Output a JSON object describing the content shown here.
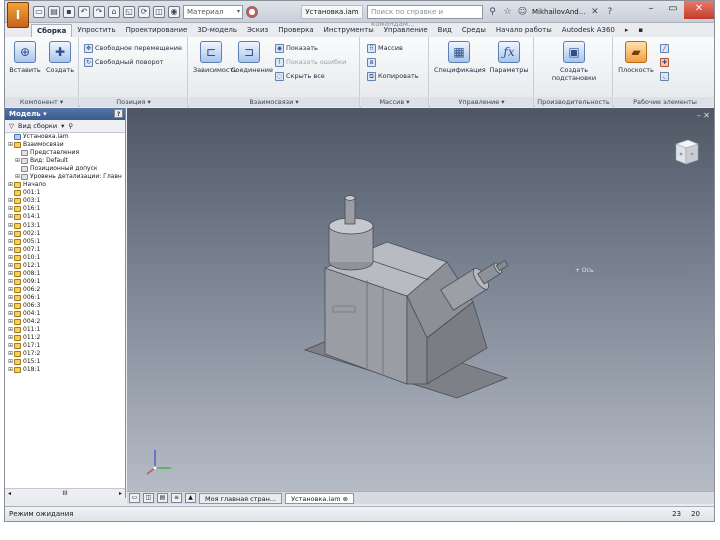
{
  "titlebar": {
    "material": "Материал",
    "doc_title": "Установка.iam",
    "search_placeholder": "Поиск по справке и командам...",
    "user": "MikhailovAnd...",
    "help": "?"
  },
  "tabs": [
    "Сборка",
    "Упростить",
    "Проектирование",
    "3D-модель",
    "Эскиз",
    "Проверка",
    "Инструменты",
    "Управление",
    "Вид",
    "Среды",
    "Начало работы",
    "Autodesk A360"
  ],
  "active_tab": 0,
  "ribbon": {
    "component": {
      "label": "Компонент ▾",
      "insert": "Вставить",
      "create": "Создать"
    },
    "position": {
      "label": "Позиция ▾",
      "free_move": "Свободное перемещение",
      "free_rotate": "Свободный поворот"
    },
    "relationships": {
      "label": "Взаимосвязи ▾",
      "constrain": "Зависимость",
      "join": "Соединение",
      "show": "Показать",
      "show_sick": "Показать ошибки",
      "hide_all": "Скрыть все"
    },
    "pattern": {
      "label": "Массив ▾",
      "pattern": "Массив",
      "copy": "Копировать"
    },
    "manage": {
      "label": "Управление ▾",
      "bom": "Спецификация",
      "parameters": "Параметры"
    },
    "productivity": {
      "label": "Производительность",
      "create_substitutes": "Создать подстановки"
    },
    "work_features": {
      "label": "Рабочие элементы",
      "plane": "Плоскость"
    }
  },
  "browser": {
    "title": "Модель ▾",
    "help": "?",
    "view": "Вид сборки",
    "scroll_left": "◂",
    "scroll_mid": "III",
    "scroll_right": "▸",
    "tree": [
      {
        "label": "Установка.iam",
        "icon": "assembly",
        "indent": 0,
        "exp": ""
      },
      {
        "label": "Взаимосвязи",
        "icon": "folder",
        "indent": 0,
        "exp": "⊞"
      },
      {
        "label": "Представления",
        "icon": "plain",
        "indent": 1,
        "exp": ""
      },
      {
        "label": "Вид: Default",
        "icon": "plain",
        "indent": 1,
        "exp": "⊞"
      },
      {
        "label": "Позиционный допуск",
        "icon": "plain",
        "indent": 1,
        "exp": ""
      },
      {
        "label": "Уровень детализации: Главн",
        "icon": "plain",
        "indent": 1,
        "exp": "⊞"
      },
      {
        "label": "Начало",
        "icon": "folder",
        "indent": 0,
        "exp": "⊞"
      },
      {
        "label": "001:1",
        "icon": "part",
        "indent": 0,
        "exp": ""
      },
      {
        "label": "003:1",
        "icon": "part",
        "indent": 0,
        "exp": "⊞"
      },
      {
        "label": "016:1",
        "icon": "part",
        "indent": 0,
        "exp": "⊞"
      },
      {
        "label": "014:1",
        "icon": "part",
        "indent": 0,
        "exp": "⊞"
      },
      {
        "label": "013:1",
        "icon": "part",
        "indent": 0,
        "exp": "⊞"
      },
      {
        "label": "002:1",
        "icon": "part",
        "indent": 0,
        "exp": "⊞"
      },
      {
        "label": "005:1",
        "icon": "part",
        "indent": 0,
        "exp": "⊞"
      },
      {
        "label": "007:1",
        "icon": "part",
        "indent": 0,
        "exp": "⊞"
      },
      {
        "label": "010:1",
        "icon": "part",
        "indent": 0,
        "exp": "⊞"
      },
      {
        "label": "012:1",
        "icon": "part",
        "indent": 0,
        "exp": "⊞"
      },
      {
        "label": "008:1",
        "icon": "part",
        "indent": 0,
        "exp": "⊞"
      },
      {
        "label": "009:1",
        "icon": "part",
        "indent": 0,
        "exp": "⊞"
      },
      {
        "label": "006:2",
        "icon": "part",
        "indent": 0,
        "exp": "⊞"
      },
      {
        "label": "006:1",
        "icon": "part",
        "indent": 0,
        "exp": "⊞"
      },
      {
        "label": "006:3",
        "icon": "part",
        "indent": 0,
        "exp": "⊞"
      },
      {
        "label": "004:1",
        "icon": "part",
        "indent": 0,
        "exp": "⊞"
      },
      {
        "label": "004:2",
        "icon": "part",
        "indent": 0,
        "exp": "⊞"
      },
      {
        "label": "011:1",
        "icon": "part",
        "indent": 0,
        "exp": "⊞"
      },
      {
        "label": "011:2",
        "icon": "part",
        "indent": 0,
        "exp": "⊞"
      },
      {
        "label": "017:1",
        "icon": "part",
        "indent": 0,
        "exp": "⊞"
      },
      {
        "label": "017:2",
        "icon": "part",
        "indent": 0,
        "exp": "⊞"
      },
      {
        "label": "015:1",
        "icon": "part",
        "indent": 0,
        "exp": "⊞"
      },
      {
        "label": "018:1",
        "icon": "part",
        "indent": 0,
        "exp": "⊞"
      }
    ]
  },
  "viewport": {
    "pill_text": "+ Ось"
  },
  "doc_tabs": {
    "home": "Моя главная стран...",
    "doc": "Установка.iam"
  },
  "status": {
    "text": "Режим ожидания",
    "num1": "23",
    "num2": "20"
  },
  "colors": {
    "accent": "#3c5a8d",
    "app_button": "#e07b25",
    "viewport_top": "#4f5765",
    "viewport_bottom": "#b6bcc6",
    "model_gray": "#8f9299"
  }
}
